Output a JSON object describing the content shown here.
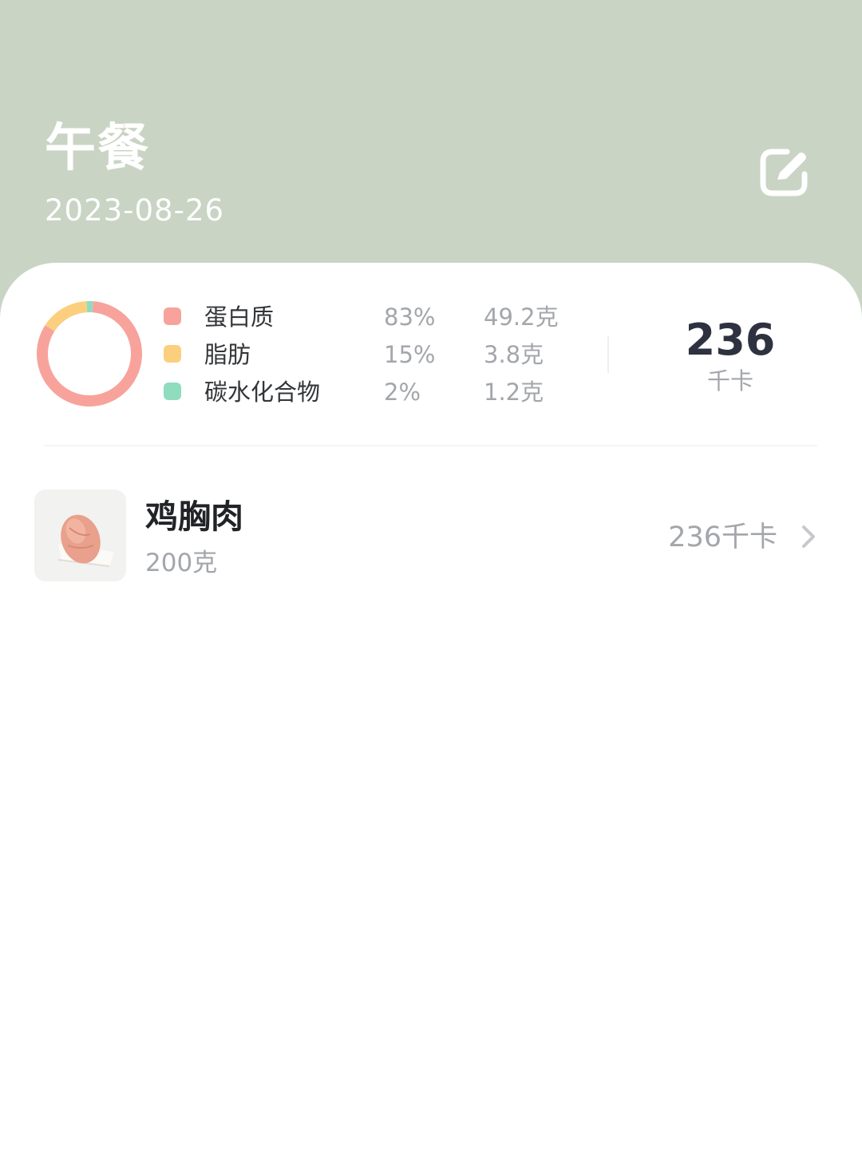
{
  "header": {
    "meal": "午餐",
    "date": "2023-08-26",
    "edit_icon": "edit-icon"
  },
  "nutrition": {
    "macros": [
      {
        "name": "蛋白质",
        "percent": "83%",
        "grams": "49.2克",
        "color": "#f7a39b",
        "share": 0.83
      },
      {
        "name": "脂肪",
        "percent": "15%",
        "grams": "3.8克",
        "color": "#fbcf7e",
        "share": 0.15
      },
      {
        "name": "碳水化合物",
        "percent": "2%",
        "grams": "1.2克",
        "color": "#8fdcbf",
        "share": 0.02
      }
    ],
    "total_kcal": "236",
    "kcal_unit": "千卡"
  },
  "foods": [
    {
      "name": "鸡胸肉",
      "amount": "200克",
      "kcal": "236千卡",
      "chevron_icon": "chevron-right-icon",
      "image": "chicken-breast-photo"
    }
  ],
  "colors": {
    "header_bg": "#c9d4c4",
    "card_bg": "#ffffff",
    "protein": "#f7a39b",
    "fat": "#fbcf7e",
    "carbs": "#8fdcbf"
  }
}
